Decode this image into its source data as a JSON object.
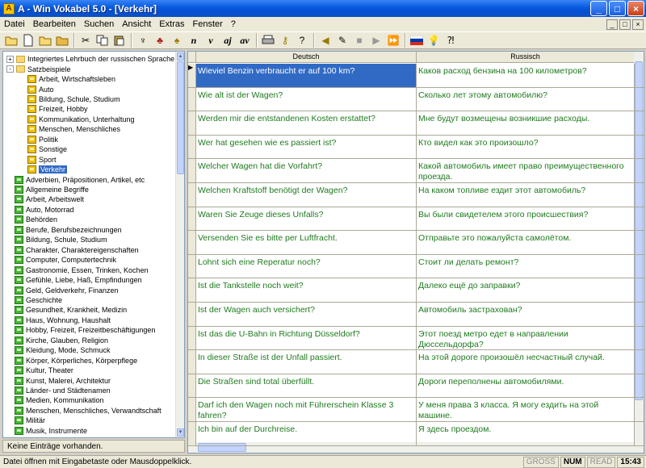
{
  "window": {
    "title": "A - Win Vokabel 5.0 - [Verkehr]",
    "icon_letter": "A",
    "minimize": "_",
    "maximize": "□",
    "close": "×"
  },
  "menu": [
    "Datei",
    "Bearbeiten",
    "Suchen",
    "Ansicht",
    "Extras",
    "Fenster",
    "?"
  ],
  "toolbar_letters": [
    "n",
    "v",
    "aj",
    "av"
  ],
  "tree": {
    "items": [
      {
        "label": "Integriertes Lehrbuch der russischen Sprache",
        "level": 0,
        "icon": "folder",
        "expander": "+"
      },
      {
        "label": "Satzbeispiele",
        "level": 0,
        "icon": "folder",
        "expander": "-"
      },
      {
        "label": "Arbeit, Wirtschaftsleben",
        "level": 1,
        "icon": "book-y"
      },
      {
        "label": "Auto",
        "level": 1,
        "icon": "book-y"
      },
      {
        "label": "Bildung, Schule, Studium",
        "level": 1,
        "icon": "book-y"
      },
      {
        "label": "Freizeit, Hobby",
        "level": 1,
        "icon": "book-y"
      },
      {
        "label": "Kommunikation, Unterhaltung",
        "level": 1,
        "icon": "book-y"
      },
      {
        "label": "Menschen, Menschliches",
        "level": 1,
        "icon": "book-y"
      },
      {
        "label": "Politik",
        "level": 1,
        "icon": "book-y"
      },
      {
        "label": "Sonstige",
        "level": 1,
        "icon": "book-y"
      },
      {
        "label": "Sport",
        "level": 1,
        "icon": "book-y"
      },
      {
        "label": "Verkehr",
        "level": 1,
        "icon": "book-y",
        "selected": true
      },
      {
        "label": "Adverbien, Präpositionen, Artikel, etc",
        "level": 0,
        "icon": "book"
      },
      {
        "label": "Allgemeine Begriffe",
        "level": 0,
        "icon": "book"
      },
      {
        "label": "Arbeit, Arbeitswelt",
        "level": 0,
        "icon": "book"
      },
      {
        "label": "Auto, Motorrad",
        "level": 0,
        "icon": "book"
      },
      {
        "label": "Behörden",
        "level": 0,
        "icon": "book"
      },
      {
        "label": "Berufe, Berufsbezeichnungen",
        "level": 0,
        "icon": "book"
      },
      {
        "label": "Bildung, Schule, Studium",
        "level": 0,
        "icon": "book"
      },
      {
        "label": "Charakter, Charaktereigenschaften",
        "level": 0,
        "icon": "book"
      },
      {
        "label": "Computer, Computertechnik",
        "level": 0,
        "icon": "book"
      },
      {
        "label": "Gastronomie, Essen, Trinken, Kochen",
        "level": 0,
        "icon": "book"
      },
      {
        "label": "Gefühle, Liebe, Haß, Empfindungen",
        "level": 0,
        "icon": "book"
      },
      {
        "label": "Geld, Geldverkehr, Finanzen",
        "level": 0,
        "icon": "book"
      },
      {
        "label": "Geschichte",
        "level": 0,
        "icon": "book"
      },
      {
        "label": "Gesundheit, Krankheit, Medizin",
        "level": 0,
        "icon": "book"
      },
      {
        "label": "Haus, Wohnung, Haushalt",
        "level": 0,
        "icon": "book"
      },
      {
        "label": "Hobby, Freizeit, Freizeitbeschäftigungen",
        "level": 0,
        "icon": "book"
      },
      {
        "label": "Kirche, Glauben, Religion",
        "level": 0,
        "icon": "book"
      },
      {
        "label": "Kleidung, Mode, Schmuck",
        "level": 0,
        "icon": "book"
      },
      {
        "label": "Körper, Körperliches, Körperpflege",
        "level": 0,
        "icon": "book"
      },
      {
        "label": "Kultur, Theater",
        "level": 0,
        "icon": "book"
      },
      {
        "label": "Kunst, Malerei, Architektur",
        "level": 0,
        "icon": "book"
      },
      {
        "label": "Länder- und Städtenamen",
        "level": 0,
        "icon": "book"
      },
      {
        "label": "Medien, Kommunikation",
        "level": 0,
        "icon": "book"
      },
      {
        "label": "Menschen, Menschliches, Verwandtschaft",
        "level": 0,
        "icon": "book"
      },
      {
        "label": "Militär",
        "level": 0,
        "icon": "book"
      },
      {
        "label": "Musik, Instrumente",
        "level": 0,
        "icon": "book"
      }
    ],
    "status": "Keine Einträge vorhanden."
  },
  "grid": {
    "columns": [
      "Deutsch",
      "Russisch"
    ],
    "rows": [
      {
        "de": "Wieviel Benzin verbraucht er auf 100 km?",
        "ru": "Каков расход бензина на 100 километров?",
        "selected": true
      },
      {
        "de": "Wie alt ist der Wagen?",
        "ru": "Сколько лет этому автомобилю?"
      },
      {
        "de": "Werden mir die entstandenen Kosten erstattet?",
        "ru": "Мне будут возмещены возникшие расходы."
      },
      {
        "de": "Wer hat gesehen wie es passiert ist?",
        "ru": "Кто видел как это произошло?"
      },
      {
        "de": "Welcher Wagen hat die Vorfahrt?",
        "ru": "Какой автомобиль имеет право преимущественного проезда."
      },
      {
        "de": "Welchen Kraftstoff benötigt der Wagen?",
        "ru": "На каком топливе ездит этот автомобиль?"
      },
      {
        "de": "Waren Sie Zeuge dieses Unfalls?",
        "ru": "Вы были свидетелем этого происшествия?"
      },
      {
        "de": "Versenden Sie es bitte per Luftfracht.",
        "ru": "Отправьте это пожалуйста самолётом."
      },
      {
        "de": "Lohnt sich eine Reperatur noch?",
        "ru": "Стоит ли делать ремонт?"
      },
      {
        "de": "Ist die Tankstelle noch weit?",
        "ru": "Далеко ещё до заправки?"
      },
      {
        "de": "Ist der Wagen auch versichert?",
        "ru": "Автомобиль застрахован?"
      },
      {
        "de": "Ist das die U-Bahn in Richtung Düsseldorf?",
        "ru": "Этот поезд метро едет  в направлении Дюссельдорфа?"
      },
      {
        "de": "In dieser Straße ist der Unfall passiert.",
        "ru": "На этой дороге произошёл несчастный случай."
      },
      {
        "de": "Die Straßen sind total überfüllt.",
        "ru": "Дороги переполнены автомобилями."
      },
      {
        "de": "Darf ich den Wagen noch mit Führerschein Klasse 3 fahren?",
        "ru": "У меня права 3 класса. Я могу ездить на этой машине."
      },
      {
        "de": "Ich bin auf der Durchreise.",
        "ru": "Я здесь  проездом."
      }
    ]
  },
  "status": {
    "message": "Datei öffnen mit Eingabetaste oder Mausdoppelklick.",
    "panels": [
      "GROSS",
      "NUM",
      "READ",
      "15:43"
    ]
  },
  "colors": {
    "title_blue": "#0550d6",
    "selection": "#316ac5",
    "text_green": "#1f7a1f"
  }
}
